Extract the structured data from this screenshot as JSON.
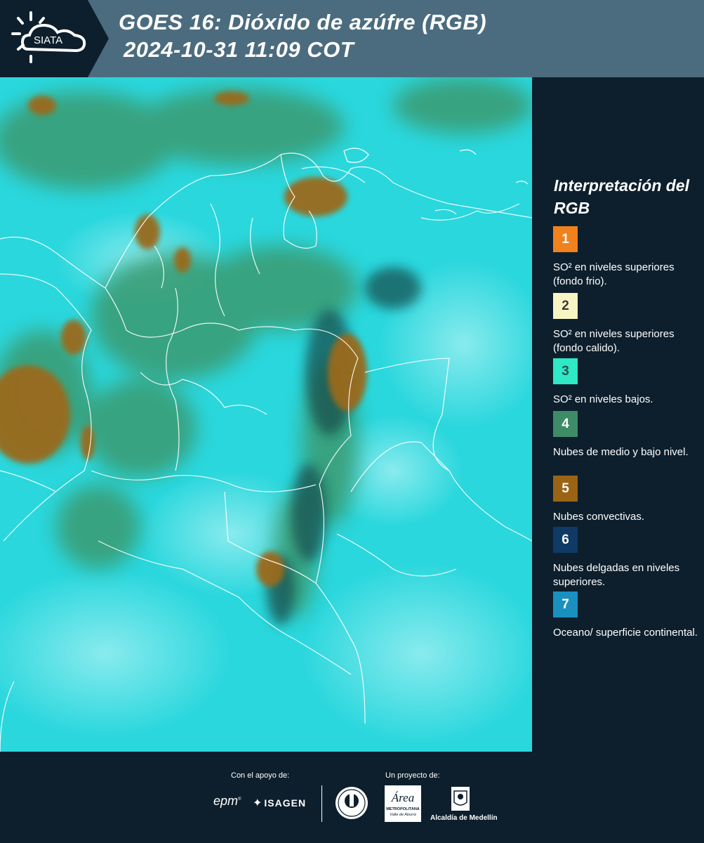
{
  "header": {
    "logo_text": "SIATA",
    "title_line1": "GOES 16: Dióxido de azúfre (RGB)",
    "title_line2": "2024-10-31 11:09 COT",
    "background_color": "#4b6c7e"
  },
  "map": {
    "icon": "satellite-image-colombia",
    "ocean_color": "#2ad7dd"
  },
  "legend": {
    "title": "Interpretación del RGB",
    "items": [
      {
        "number": "1",
        "color": "#f0821e",
        "label": "SO² en niveles superiores (fondo frio)."
      },
      {
        "number": "2",
        "color": "#f8f4c4",
        "label": "SO² en niveles superiores (fondo calido)."
      },
      {
        "number": "3",
        "color": "#2ee8c6",
        "label": "SO² en niveles bajos."
      },
      {
        "number": "4",
        "color": "#3e8b68",
        "label": "Nubes de medio y bajo nivel."
      },
      {
        "number": "5",
        "color": "#9a6414",
        "label": "Nubes convectivas."
      },
      {
        "number": "6",
        "color": "#0f3a66",
        "label": "Nubes delgadas en niveles superiores."
      },
      {
        "number": "7",
        "color": "#1a90c0",
        "label": "Oceano/ superficie continental."
      }
    ]
  },
  "footer": {
    "support_label": "Con el apoyo de:",
    "project_label": "Un proyecto de:",
    "sponsor_1": "epm",
    "sponsor_2": "ISAGEN",
    "partner_2_title": "Área",
    "partner_2_sub1": "METROPOLITANA",
    "partner_2_sub2": "Valle de Aburrá",
    "partner_3": "Alcaldía de Medellín"
  }
}
